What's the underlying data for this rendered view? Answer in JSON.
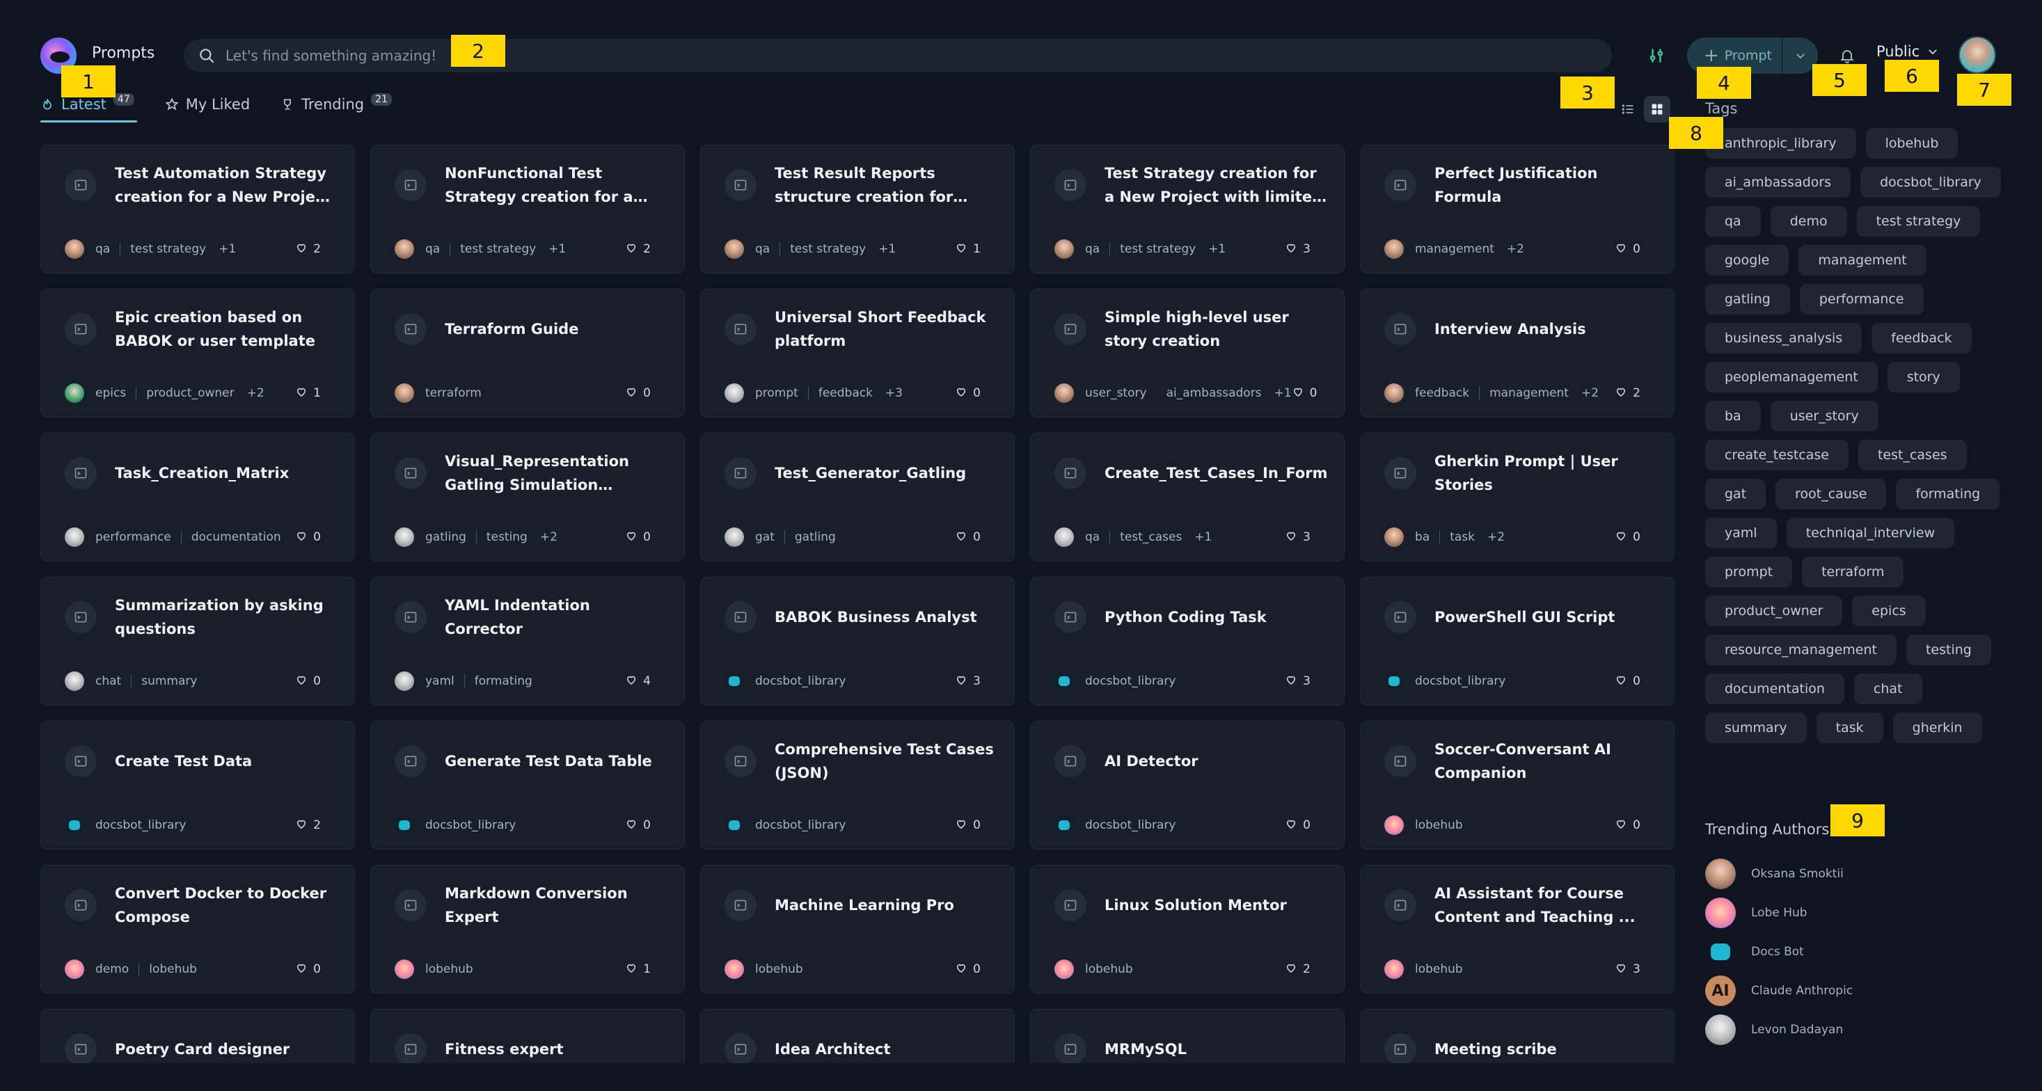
{
  "header": {
    "app_title": "Prompts",
    "search_placeholder": "Let's find something amazing!",
    "new_prompt_label": "Prompt",
    "visibility_label": "Public"
  },
  "tabs": [
    {
      "label": "Latest",
      "count": "47",
      "icon": "flame-icon"
    },
    {
      "label": "My Liked",
      "count": "",
      "icon": "star-icon"
    },
    {
      "label": "Trending",
      "count": "21",
      "icon": "trophy-icon"
    }
  ],
  "cards": [
    {
      "title": "Test Automation Strategy creation for a New Project ...",
      "tags": [
        "qa",
        "test strategy"
      ],
      "more": "+1",
      "likes": "2",
      "fav": "person"
    },
    {
      "title": "NonFunctional Test Strategy creation for a New Project ...",
      "tags": [
        "qa",
        "test strategy"
      ],
      "more": "+1",
      "likes": "2",
      "fav": "person"
    },
    {
      "title": "Test Result Reports structure creation for different groups ...",
      "tags": [
        "qa",
        "test strategy"
      ],
      "more": "+1",
      "likes": "1",
      "fav": "person"
    },
    {
      "title": "Test Strategy creation for a New Project with limited ...",
      "tags": [
        "qa",
        "test strategy"
      ],
      "more": "+1",
      "likes": "3",
      "fav": "person"
    },
    {
      "title": "Perfect Justification Formula",
      "tags": [
        "management"
      ],
      "more": "+2",
      "likes": "0",
      "fav": "person"
    },
    {
      "title": "Epic creation based on BABOK or user template",
      "tags": [
        "epics",
        "product_owner"
      ],
      "more": "+2",
      "likes": "1",
      "fav": "green"
    },
    {
      "title": "Terraform Guide",
      "tags": [
        "terraform"
      ],
      "more": "",
      "likes": "0",
      "fav": "person"
    },
    {
      "title": "Universal Short Feedback platform",
      "tags": [
        "prompt",
        "feedback"
      ],
      "more": "+3",
      "likes": "0",
      "fav": "gray"
    },
    {
      "title": "Simple high-level user story creation",
      "tags": [
        "user_story",
        "ai_ambassadors"
      ],
      "more": "+1",
      "likes": "0",
      "fav": "person"
    },
    {
      "title": "Interview Analysis",
      "tags": [
        "feedback",
        "management"
      ],
      "more": "+2",
      "likes": "2",
      "fav": "person"
    },
    {
      "title": "Task_Creation_Matrix",
      "tags": [
        "performance",
        "documentation"
      ],
      "more": "",
      "likes": "0",
      "fav": "gray"
    },
    {
      "title": "Visual_Representation Gatling Simulation Structure and ...",
      "tags": [
        "gatling",
        "testing"
      ],
      "more": "+2",
      "likes": "0",
      "fav": "gray"
    },
    {
      "title": "Test_Generator_Gatling",
      "tags": [
        "gat",
        "gatling"
      ],
      "more": "",
      "likes": "0",
      "fav": "gray"
    },
    {
      "title": "Create_Test_Cases_In_Format",
      "tags": [
        "qa",
        "test_cases"
      ],
      "more": "+1",
      "likes": "3",
      "fav": "gray"
    },
    {
      "title": "Gherkin Prompt | User Stories",
      "tags": [
        "ba",
        "task"
      ],
      "more": "+2",
      "likes": "0",
      "fav": "person"
    },
    {
      "title": "Summarization by asking questions",
      "tags": [
        "chat",
        "summary"
      ],
      "more": "",
      "likes": "0",
      "fav": "gray"
    },
    {
      "title": "YAML Indentation Corrector",
      "tags": [
        "yaml",
        "formating"
      ],
      "more": "",
      "likes": "4",
      "fav": "gray"
    },
    {
      "title": "BABOK Business Analyst",
      "tags": [
        "docsbot_library"
      ],
      "more": "",
      "likes": "3",
      "fav": "bot"
    },
    {
      "title": "Python Coding Task",
      "tags": [
        "docsbot_library"
      ],
      "more": "",
      "likes": "3",
      "fav": "bot"
    },
    {
      "title": "PowerShell GUI Script",
      "tags": [
        "docsbot_library"
      ],
      "more": "",
      "likes": "0",
      "fav": "bot"
    },
    {
      "title": "Create Test Data",
      "tags": [
        "docsbot_library"
      ],
      "more": "",
      "likes": "2",
      "fav": "bot"
    },
    {
      "title": "Generate Test Data Table",
      "tags": [
        "docsbot_library"
      ],
      "more": "",
      "likes": "0",
      "fav": "bot"
    },
    {
      "title": "Comprehensive Test Cases (JSON)",
      "tags": [
        "docsbot_library"
      ],
      "more": "",
      "likes": "0",
      "fav": "bot"
    },
    {
      "title": "AI Detector",
      "tags": [
        "docsbot_library"
      ],
      "more": "",
      "likes": "0",
      "fav": "bot"
    },
    {
      "title": "Soccer-Conversant AI Companion",
      "tags": [
        "lobehub"
      ],
      "more": "",
      "likes": "0",
      "fav": "lobe"
    },
    {
      "title": "Convert Docker to Docker Compose",
      "tags": [
        "demo",
        "lobehub"
      ],
      "more": "",
      "likes": "0",
      "fav": "lobe"
    },
    {
      "title": "Markdown Conversion Expert",
      "tags": [
        "lobehub"
      ],
      "more": "",
      "likes": "1",
      "fav": "lobe"
    },
    {
      "title": "Machine Learning Pro",
      "tags": [
        "lobehub"
      ],
      "more": "",
      "likes": "0",
      "fav": "lobe"
    },
    {
      "title": "Linux Solution Mentor",
      "tags": [
        "lobehub"
      ],
      "more": "",
      "likes": "2",
      "fav": "lobe"
    },
    {
      "title": "AI Assistant for Course Content and Teaching ...",
      "tags": [
        "lobehub"
      ],
      "more": "",
      "likes": "3",
      "fav": "lobe"
    },
    {
      "title": "Poetry Card designer",
      "tags": [],
      "more": "",
      "likes": "",
      "fav": "lobe"
    },
    {
      "title": "Fitness expert",
      "tags": [],
      "more": "",
      "likes": "",
      "fav": "lobe"
    },
    {
      "title": "Idea Architect",
      "tags": [],
      "more": "",
      "likes": "",
      "fav": "lobe"
    },
    {
      "title": "MRMySQL",
      "tags": [],
      "more": "",
      "likes": "",
      "fav": "lobe"
    },
    {
      "title": "Meeting scribe",
      "tags": [],
      "more": "",
      "likes": "",
      "fav": "lobe"
    }
  ],
  "sidebar": {
    "tags_title": "Tags",
    "tags": [
      "anthropic_library",
      "lobehub",
      "ai_ambassadors",
      "docsbot_library",
      "qa",
      "demo",
      "test strategy",
      "google",
      "management",
      "gatling",
      "performance",
      "business_analysis",
      "feedback",
      "peoplemanagement",
      "story",
      "ba",
      "user_story",
      "create_testcase",
      "test_cases",
      "gat",
      "root_cause",
      "formating",
      "yaml",
      "techniqal_interview",
      "prompt",
      "terraform",
      "product_owner",
      "epics",
      "resource_management",
      "testing",
      "documentation",
      "chat",
      "summary",
      "task",
      "gherkin"
    ],
    "authors_title": "Trending Authors",
    "authors": [
      {
        "name": "Oksana Smoktii",
        "avatar": "person"
      },
      {
        "name": "Lobe Hub",
        "avatar": "lobe"
      },
      {
        "name": "Docs Bot",
        "avatar": "bot"
      },
      {
        "name": "Claude Anthropic",
        "avatar": "anthropic",
        "initials": "AI"
      },
      {
        "name": "Levon Dadayan",
        "avatar": "gray"
      }
    ]
  },
  "markers": [
    "1",
    "2",
    "3",
    "4",
    "5",
    "6",
    "7",
    "8",
    "9"
  ],
  "colors": {
    "background": "#0e1420",
    "card": "#181f2b",
    "accent": "#6ec7e6",
    "marker": "#ffd800"
  }
}
